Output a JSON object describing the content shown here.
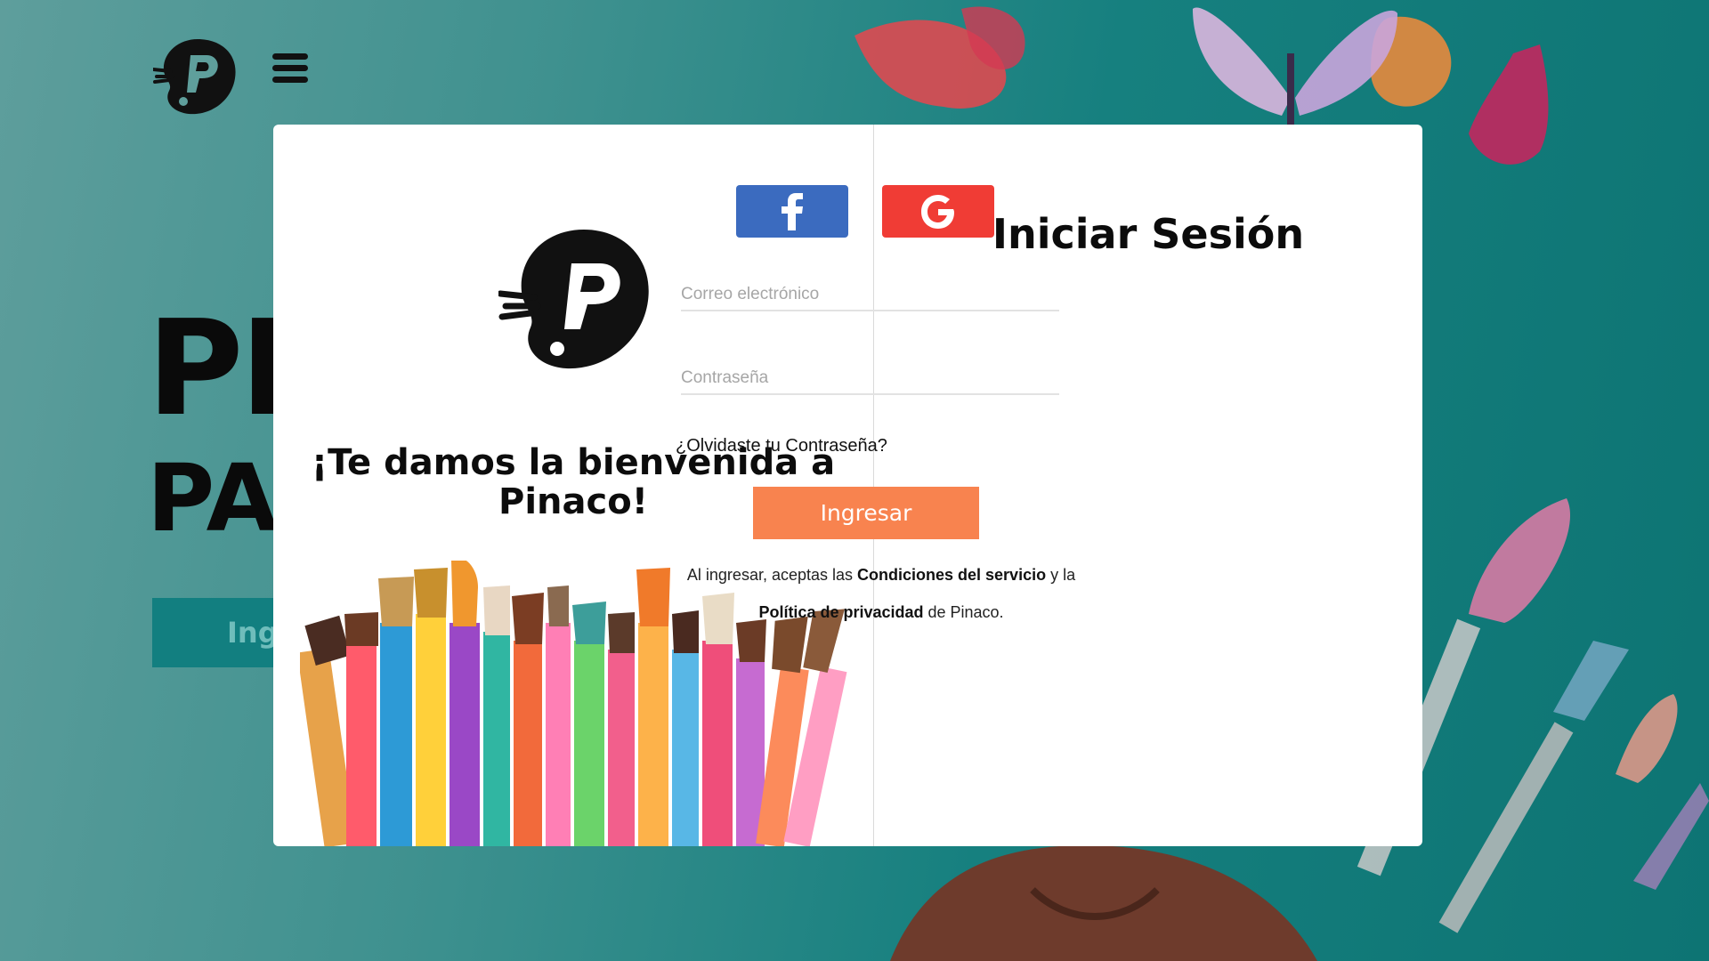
{
  "background": {
    "hero_line1": "PI",
    "hero_line2": "PA",
    "cta_label": "Ing",
    "logo_icon": "pinaco-palette-logo",
    "menu_icon": "hamburger-menu-icon"
  },
  "welcome": {
    "title": "¡Te damos la bienvenida a Pinaco!",
    "logo_icon": "pinaco-palette-logo",
    "image": "paint-brushes-illustration"
  },
  "login": {
    "title": "Iniciar Sesión",
    "facebook_icon": "facebook-icon",
    "google_icon": "google-icon",
    "email_placeholder": "Correo electrónico",
    "password_placeholder": "Contraseña",
    "forgot_label": "¿Olvidaste tu Contraseña?",
    "submit_label": "Ingresar",
    "terms_prefix": "Al ingresar,  aceptas las ",
    "terms_link": "Condiciones del servicio",
    "terms_middle": " y la",
    "privacy_link": "Política de privacidad",
    "terms_suffix": " de Pinaco."
  },
  "colors": {
    "facebook": "#3b6bbf",
    "google": "#f03c35",
    "submit": "#f8834f",
    "background_teal": "#16807f"
  }
}
